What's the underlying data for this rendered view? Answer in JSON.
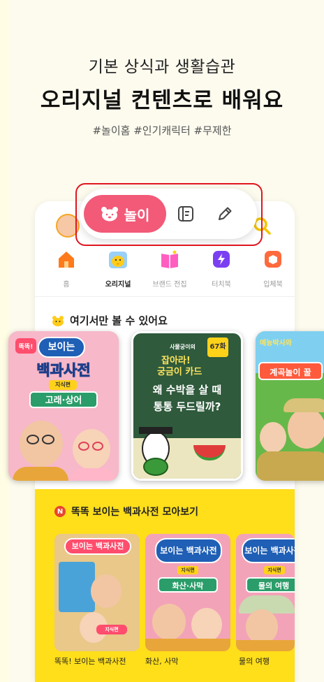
{
  "headline": {
    "sub": "기본 상식과 생활습관",
    "main": "오리지널 컨텐츠로 배워요",
    "hashtags": "#놀이홈 #인기캐릭터 #무제한"
  },
  "mode_switcher": {
    "play_label": "놀이",
    "icons": [
      "bear-icon",
      "document-icon",
      "pencil-icon"
    ]
  },
  "categories": [
    {
      "label": "홈",
      "icon": "house-icon",
      "color": "#ff7a1a"
    },
    {
      "label": "오리지널",
      "icon": "character-icon",
      "color": "#ffcc1a",
      "active": true
    },
    {
      "label": "브랜드 전집",
      "icon": "book-icon",
      "color": "#ff5ec0"
    },
    {
      "label": "터치북",
      "icon": "lightning-icon",
      "color": "#7b3ff2"
    },
    {
      "label": "입체북",
      "icon": "box-icon",
      "color": "#ff6a3d"
    }
  ],
  "exclusive_section": {
    "title": "여기서만 볼 수 있어요",
    "cards": [
      {
        "badge": "똑똑!",
        "title_1": "보이는",
        "title_2": "백과사전",
        "tag": "지식편",
        "topic": "고래·상어"
      },
      {
        "top": "사물궁이의",
        "number": "67화",
        "label_1": "잡아라!",
        "label_2": "궁금이 카드",
        "question_1": "왜 수박을 살 때",
        "question_2": "통통 두드릴까?"
      },
      {
        "top": "예능박사와",
        "title": "계곡놀이 꿀"
      }
    ]
  },
  "collection_section": {
    "badge": "N",
    "title": "똑똑 보이는 백과사전 모아보기",
    "items": [
      {
        "caption": "똑똑! 보이는 백과사전",
        "thumb_tag": "지식편",
        "thumb_title": "보이는 백과사전"
      },
      {
        "caption": "화산, 사막",
        "thumb_tag": "지식편",
        "thumb_topic": "화산·사막",
        "thumb_title": "보이는 백과사전"
      },
      {
        "caption": "물의 여행",
        "thumb_tag": "지식편",
        "thumb_topic": "물의 여행",
        "thumb_title": "보이는 백과사전"
      }
    ]
  },
  "colors": {
    "background": "#fdfbee",
    "play_pink": "#f25a78",
    "highlight_red": "#e0151f",
    "section_yellow": "#ffde1a"
  }
}
